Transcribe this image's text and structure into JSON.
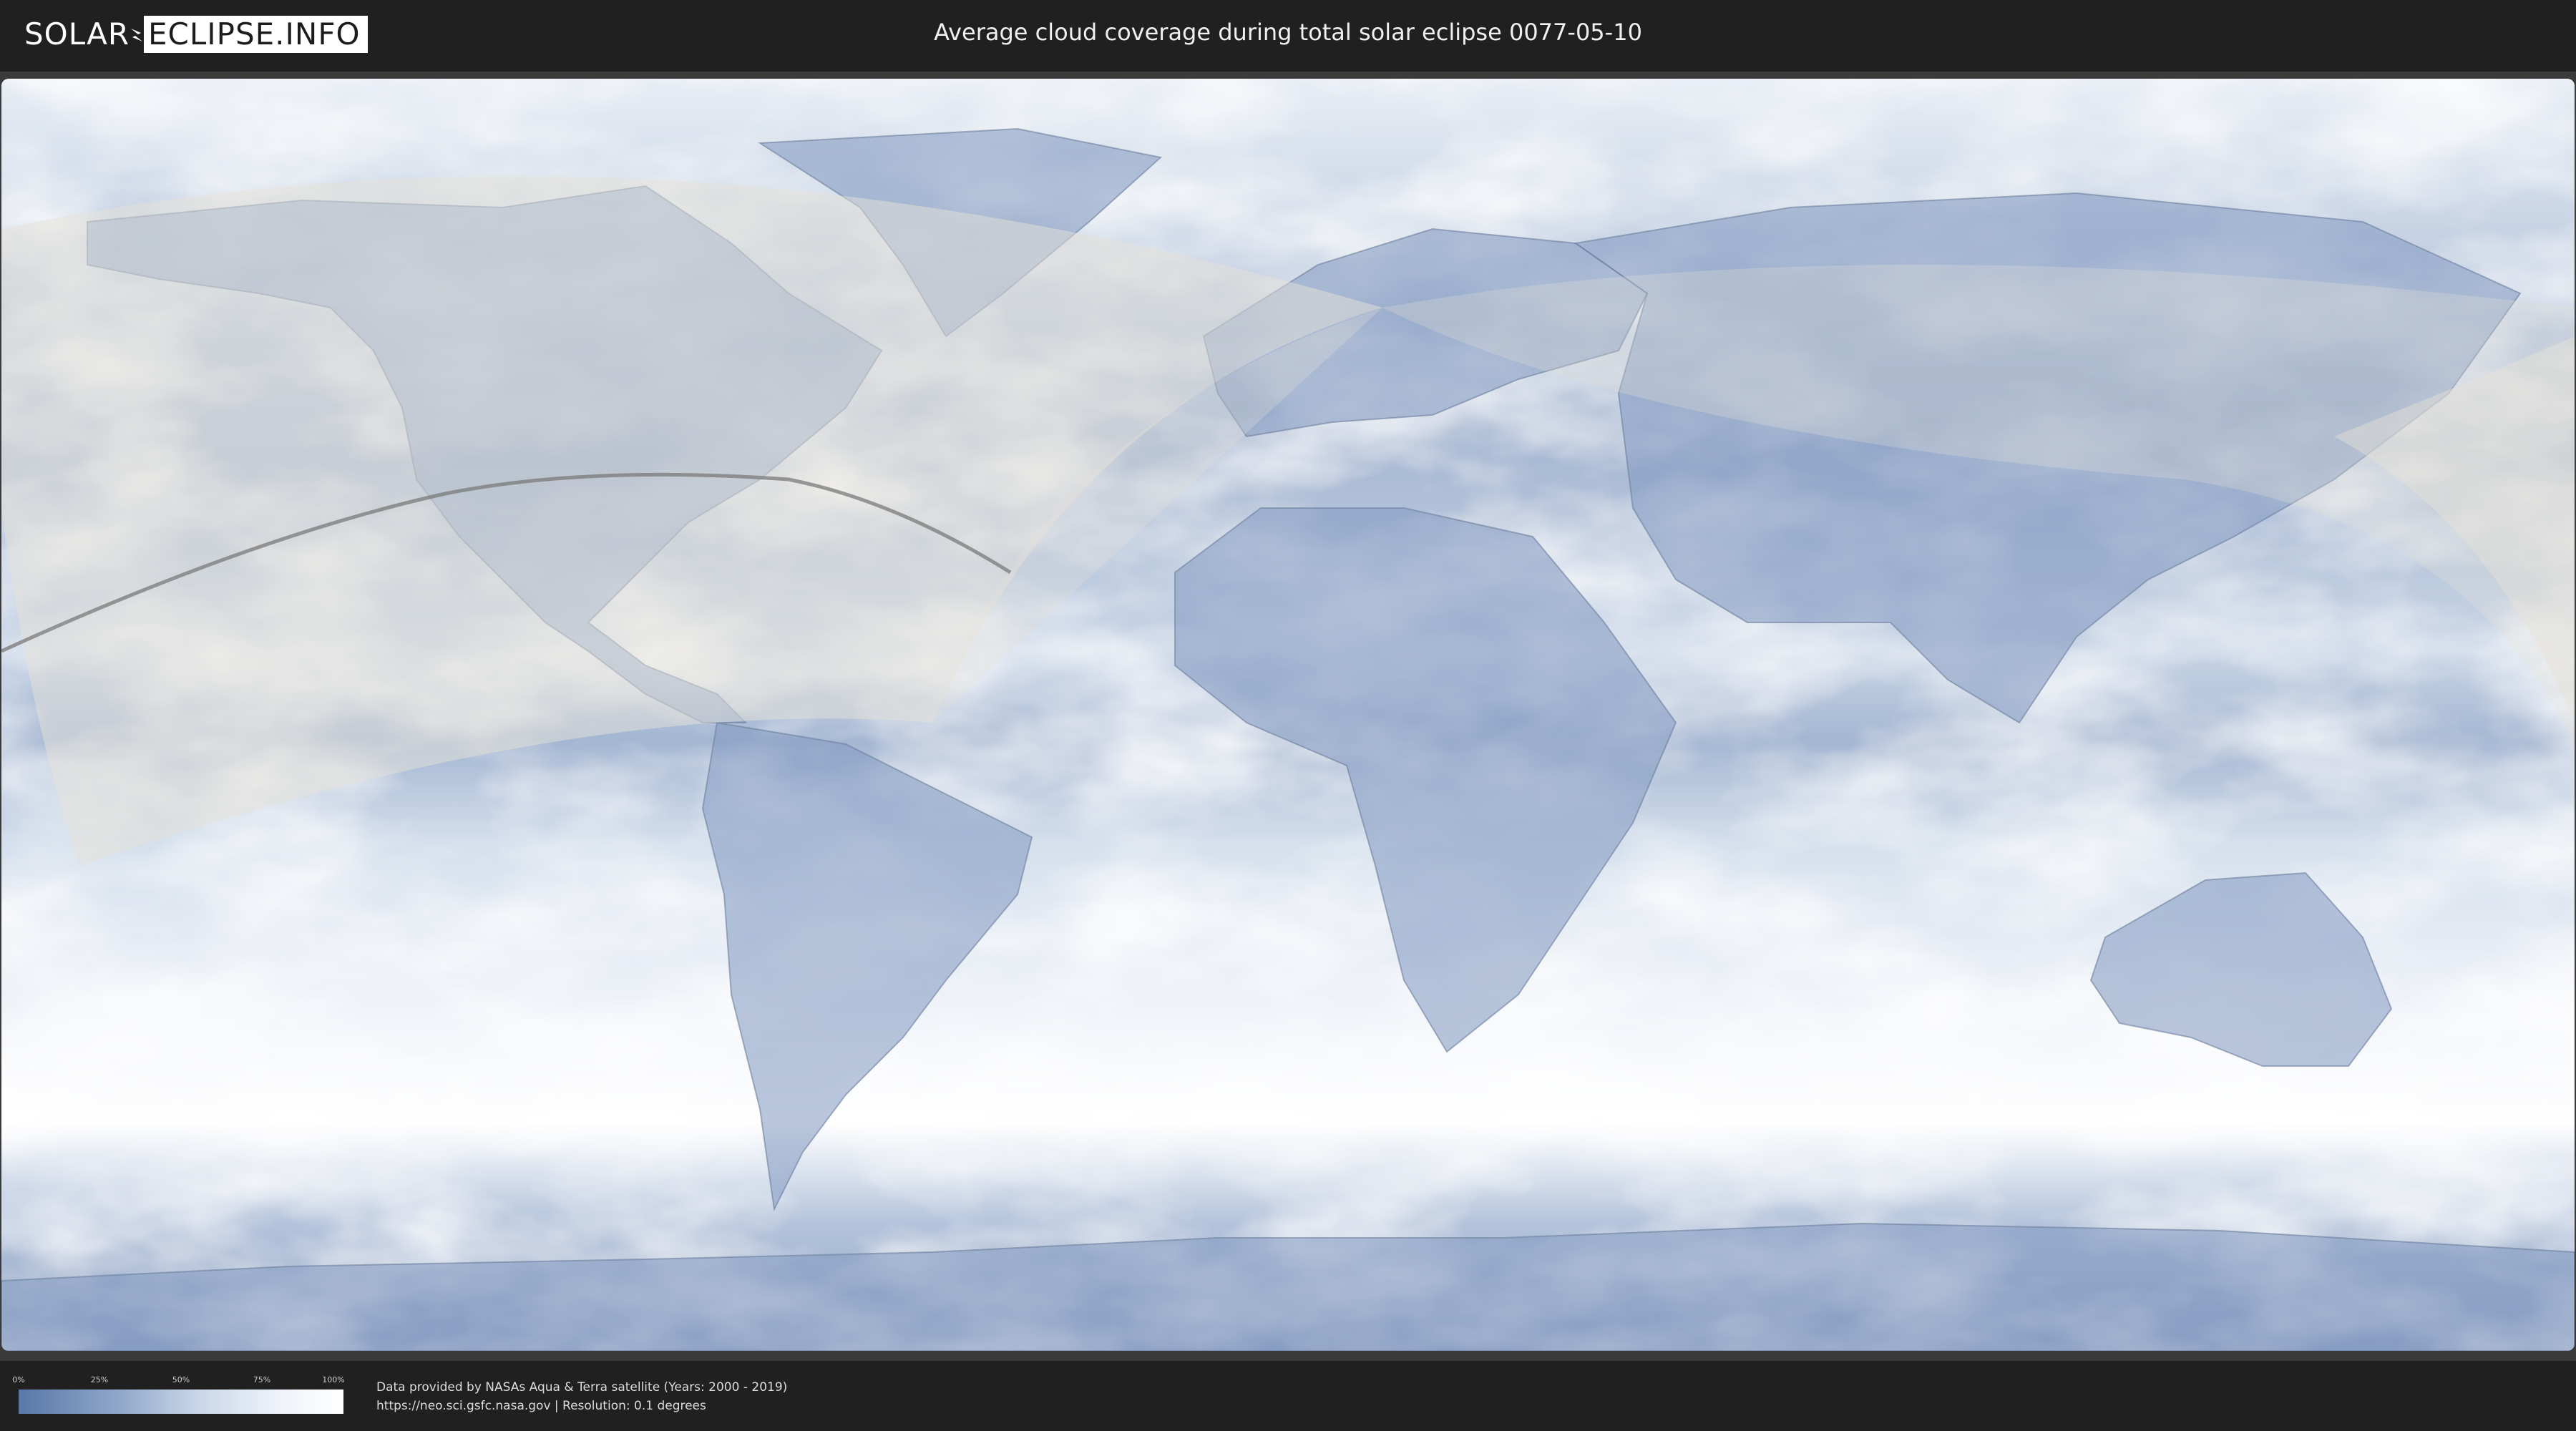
{
  "header": {
    "logo": {
      "part1": "SOLAR",
      "part2": "ECLIPSE.INFO"
    },
    "title": "Average cloud coverage during total solar eclipse 0077-05-10"
  },
  "map": {
    "description_colors": {
      "clear": "#5a77a8",
      "cloudy": "#ffffff",
      "visibility_overlay": "#e6e2d8",
      "eclipse_path": "#7a7a7a"
    }
  },
  "legend": {
    "ticks": [
      "0%",
      "25%",
      "50%",
      "75%",
      "100%"
    ]
  },
  "footer": {
    "line1": "Data provided by NASAs Aqua & Terra satellite (Years: 2000 - 2019)",
    "line2": "https://neo.sci.gsfc.nasa.gov | Resolution: 0.1 degrees"
  }
}
